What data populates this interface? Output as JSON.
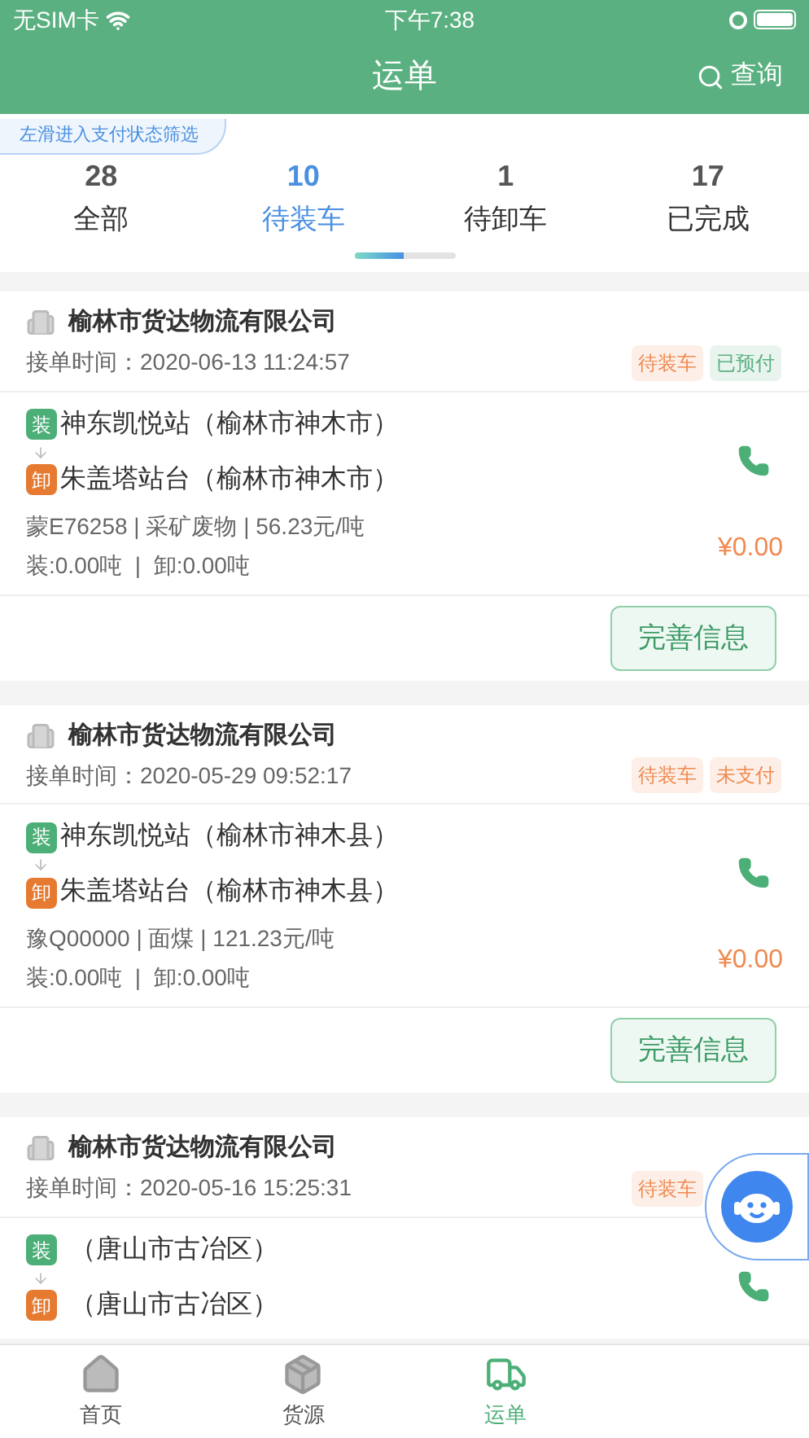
{
  "status_bar": {
    "carrier": "无SIM卡",
    "time": "下午7:38"
  },
  "header": {
    "title": "运单",
    "search": "查询"
  },
  "filter_hint": "左滑进入支付状态筛选",
  "tabs": [
    {
      "count": "28",
      "label": "全部",
      "selected": false
    },
    {
      "count": "10",
      "label": "待装车",
      "selected": true
    },
    {
      "count": "1",
      "label": "待卸车",
      "selected": false
    },
    {
      "count": "17",
      "label": "已完成",
      "selected": false
    }
  ],
  "orders": [
    {
      "company": "榆林市货达物流有限公司",
      "accepted_time": "接单时间：2020-06-13 11:24:57",
      "tags": [
        {
          "text": "待装车",
          "color": "#f08a50"
        },
        {
          "text": "已预付",
          "color": "#5bb081"
        }
      ],
      "stops": [
        {
          "kind": "load",
          "badge": "装",
          "name": "神东凯悦站",
          "region": "（榆林市神木市）"
        },
        {
          "kind": "unload",
          "badge": "卸",
          "name": "朱盖塔站台",
          "region": "（榆林市神木市）"
        }
      ],
      "details": "蒙E76258 | 采矿废物 | 56.23元/吨",
      "weights": "装:0.00吨  |  卸:0.00吨",
      "price": "¥0.00",
      "action": "完善信息"
    },
    {
      "company": "榆林市货达物流有限公司",
      "accepted_time": "接单时间：2020-05-29 09:52:17",
      "tags": [
        {
          "text": "待装车",
          "color": "#f08a50"
        },
        {
          "text": "未支付",
          "color": "#f08a50"
        }
      ],
      "stops": [
        {
          "kind": "load",
          "badge": "装",
          "name": "神东凯悦站",
          "region": "（榆林市神木县）"
        },
        {
          "kind": "unload",
          "badge": "卸",
          "name": "朱盖塔站台",
          "region": "（榆林市神木县）"
        }
      ],
      "details": "豫Q00000 | 面煤 | 121.23元/吨",
      "weights": "装:0.00吨  |  卸:0.00吨",
      "price": "¥0.00",
      "action": "完善信息"
    },
    {
      "company": "榆林市货达物流有限公司",
      "accepted_time": "接单时间：2020-05-16 15:25:31",
      "tags": [
        {
          "text": "待装车",
          "color": "#f08a50"
        }
      ],
      "stops": [
        {
          "kind": "load",
          "badge": "装",
          "region": "（唐山市古冶区）"
        },
        {
          "kind": "unload",
          "badge": "卸",
          "region": "（唐山市古冶区）"
        }
      ]
    }
  ],
  "tab_bar": [
    {
      "kind": "home",
      "label": "首页",
      "selected": false
    },
    {
      "kind": "box",
      "label": "货源",
      "selected": false
    },
    {
      "kind": "truck",
      "label": "运单",
      "selected": true
    }
  ]
}
